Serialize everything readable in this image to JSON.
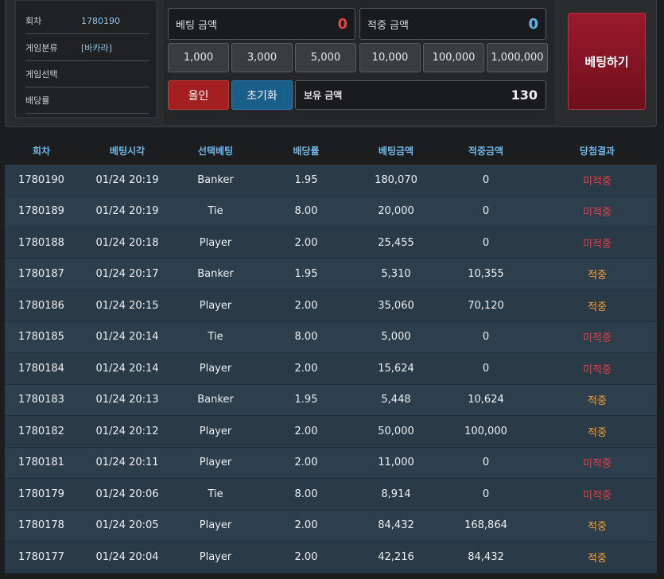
{
  "info": {
    "round_label": "회차",
    "round_value": "1780190",
    "category_label": "게임분류",
    "category_value": "[바카라]",
    "game_label": "게임선택",
    "game_value": "",
    "odds_label": "배당률",
    "odds_value": ""
  },
  "bet": {
    "bet_amount_label": "베팅 금액",
    "bet_amount_value": "0",
    "win_amount_label": "적중 금액",
    "win_amount_value": "0",
    "chips": [
      "1,000",
      "3,000",
      "5,000",
      "10,000",
      "100,000",
      "1,000,000"
    ],
    "allin_label": "올인",
    "reset_label": "초기화",
    "holding_label": "보유 금액",
    "holding_value": "130",
    "bet_button_label": "베팅하기"
  },
  "colors": {
    "bet_value": "#e0414a",
    "win_value": "#5fb4ee",
    "miss": "#e0414a",
    "hit": "#f0a23c",
    "header": "#6fb8e8"
  },
  "table": {
    "headers": [
      "회차",
      "베팅시각",
      "선택베팅",
      "배당률",
      "베팅금액",
      "적중금액",
      "당첨결과"
    ],
    "rows": [
      [
        "1780190",
        "01/24 20:19",
        "Banker",
        "1.95",
        "180,070",
        "0",
        "미적중"
      ],
      [
        "1780189",
        "01/24 20:19",
        "Tie",
        "8.00",
        "20,000",
        "0",
        "미적중"
      ],
      [
        "1780188",
        "01/24 20:18",
        "Player",
        "2.00",
        "25,455",
        "0",
        "미적중"
      ],
      [
        "1780187",
        "01/24 20:17",
        "Banker",
        "1.95",
        "5,310",
        "10,355",
        "적중"
      ],
      [
        "1780186",
        "01/24 20:15",
        "Player",
        "2.00",
        "35,060",
        "70,120",
        "적중"
      ],
      [
        "1780185",
        "01/24 20:14",
        "Tie",
        "8.00",
        "5,000",
        "0",
        "미적중"
      ],
      [
        "1780184",
        "01/24 20:14",
        "Player",
        "2.00",
        "15,624",
        "0",
        "미적중"
      ],
      [
        "1780183",
        "01/24 20:13",
        "Banker",
        "1.95",
        "5,448",
        "10,624",
        "적중"
      ],
      [
        "1780182",
        "01/24 20:12",
        "Player",
        "2.00",
        "50,000",
        "100,000",
        "적중"
      ],
      [
        "1780181",
        "01/24 20:11",
        "Player",
        "2.00",
        "11,000",
        "0",
        "미적중"
      ],
      [
        "1780179",
        "01/24 20:06",
        "Tie",
        "8.00",
        "8,914",
        "0",
        "미적중"
      ],
      [
        "1780178",
        "01/24 20:05",
        "Player",
        "2.00",
        "84,432",
        "168,864",
        "적중"
      ],
      [
        "1780177",
        "01/24 20:04",
        "Player",
        "2.00",
        "42,216",
        "84,432",
        "적중"
      ]
    ]
  }
}
